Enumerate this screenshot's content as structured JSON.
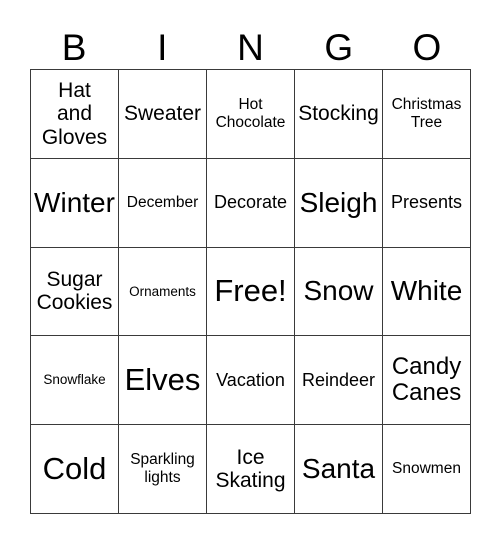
{
  "card": {
    "title": "BINGO",
    "header_letters": [
      "B",
      "I",
      "N",
      "G",
      "O"
    ],
    "grid_size": "5x5",
    "colors": {
      "background": "#ffffff",
      "text": "#000000",
      "border": "#3a3a3a"
    },
    "rows": [
      [
        {
          "text": "Hat\nand\nGloves",
          "size": "lg"
        },
        {
          "text": "Sweater",
          "size": "lg"
        },
        {
          "text": "Hot\nChocolate",
          "size": "sm"
        },
        {
          "text": "Stocking",
          "size": "lg"
        },
        {
          "text": "Christmas\nTree",
          "size": "sm"
        }
      ],
      [
        {
          "text": "Winter",
          "size": "xxl"
        },
        {
          "text": "December",
          "size": "sm"
        },
        {
          "text": "Decorate",
          "size": "md"
        },
        {
          "text": "Sleigh",
          "size": "xxl"
        },
        {
          "text": "Presents",
          "size": "md"
        }
      ],
      [
        {
          "text": "Sugar\nCookies",
          "size": "lg"
        },
        {
          "text": "Ornaments",
          "size": "xs"
        },
        {
          "text": "Free!",
          "size": "huge"
        },
        {
          "text": "Snow",
          "size": "xxl"
        },
        {
          "text": "White",
          "size": "xxl"
        }
      ],
      [
        {
          "text": "Snowflake",
          "size": "xs"
        },
        {
          "text": "Elves",
          "size": "huge"
        },
        {
          "text": "Vacation",
          "size": "md"
        },
        {
          "text": "Reindeer",
          "size": "md"
        },
        {
          "text": "Candy\nCanes",
          "size": "xl"
        }
      ],
      [
        {
          "text": "Cold",
          "size": "huge"
        },
        {
          "text": "Sparkling\nlights",
          "size": "sm"
        },
        {
          "text": "Ice\nSkating",
          "size": "lg"
        },
        {
          "text": "Santa",
          "size": "xxl"
        },
        {
          "text": "Snowmen",
          "size": "sm"
        }
      ]
    ]
  }
}
